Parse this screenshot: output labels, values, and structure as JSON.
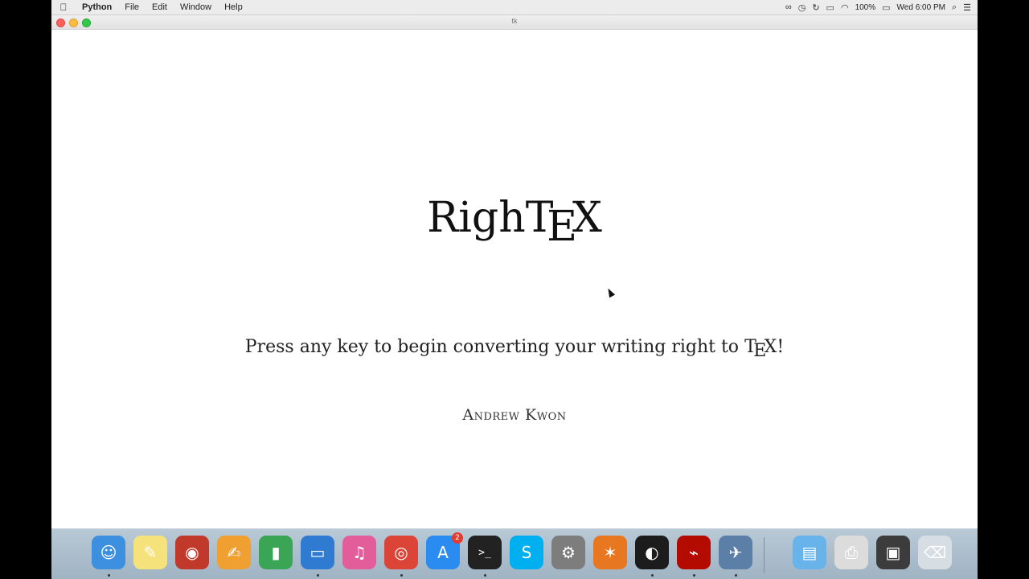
{
  "menubar": {
    "app_name": "Python",
    "menus": [
      "File",
      "Edit",
      "Window",
      "Help"
    ],
    "battery": "100%",
    "clock": "Wed 6:00 PM"
  },
  "window": {
    "title": "tk"
  },
  "content": {
    "logo_prefix": "Righ",
    "logo_tex": {
      "t": "T",
      "e": "E",
      "x": "X"
    },
    "subtitle_prefix": "Press any key to begin converting your writing right to ",
    "subtitle_tex": {
      "t": "T",
      "e": "E",
      "x": "X"
    },
    "subtitle_suffix": "!",
    "author": "Andrew Kwon"
  },
  "dock": {
    "items": [
      {
        "name": "finder",
        "icon": "finder-icon",
        "color": "#3d8fe0",
        "glyph": "☺",
        "running": true
      },
      {
        "name": "notes",
        "icon": "notes-icon",
        "color": "#f5e27a",
        "glyph": "✎",
        "running": false
      },
      {
        "name": "photo-booth",
        "icon": "photo-booth-icon",
        "color": "#c0392b",
        "glyph": "◉",
        "running": false
      },
      {
        "name": "pages",
        "icon": "pages-icon",
        "color": "#f0a030",
        "glyph": "✍",
        "running": false
      },
      {
        "name": "numbers",
        "icon": "numbers-icon",
        "color": "#3aa655",
        "glyph": "▮",
        "running": false
      },
      {
        "name": "keynote",
        "icon": "keynote-icon",
        "color": "#2e7bd1",
        "glyph": "▭",
        "running": true
      },
      {
        "name": "itunes",
        "icon": "itunes-icon",
        "color": "#e35d9a",
        "glyph": "♫",
        "running": false
      },
      {
        "name": "chrome",
        "icon": "chrome-icon",
        "color": "#db4437",
        "glyph": "◎",
        "running": true
      },
      {
        "name": "app-store",
        "icon": "app-store-icon",
        "color": "#2a8cf0",
        "glyph": "A",
        "running": false,
        "badge": "2"
      },
      {
        "name": "terminal",
        "icon": "terminal-icon",
        "color": "#222222",
        "glyph": ">_",
        "running": true
      },
      {
        "name": "skype",
        "icon": "skype-icon",
        "color": "#00aff0",
        "glyph": "S",
        "running": false
      },
      {
        "name": "system-preferences",
        "icon": "gear-icon",
        "color": "#7d7d7d",
        "glyph": "⚙",
        "running": false
      },
      {
        "name": "mathematica",
        "icon": "mathematica-icon",
        "color": "#e87722",
        "glyph": "✶",
        "running": false
      },
      {
        "name": "obs",
        "icon": "obs-icon",
        "color": "#1c1c1c",
        "glyph": "◐",
        "running": true
      },
      {
        "name": "acrobat",
        "icon": "acrobat-icon",
        "color": "#b30b00",
        "glyph": "⌁",
        "running": true
      },
      {
        "name": "python-launcher",
        "icon": "rocket-icon",
        "color": "#5c7fa8",
        "glyph": "✈",
        "running": true
      },
      {
        "name": "downloads",
        "icon": "folder-icon",
        "color": "#68b4ea",
        "glyph": "▤",
        "running": false
      },
      {
        "name": "printer",
        "icon": "printer-icon",
        "color": "#dcdcdc",
        "glyph": "⎙",
        "running": false
      },
      {
        "name": "screenshots",
        "icon": "screen-folder-icon",
        "color": "#3c3c3c",
        "glyph": "▣",
        "running": false
      },
      {
        "name": "trash",
        "icon": "trash-icon",
        "color": "#d6dde3",
        "glyph": "⌫",
        "running": false
      }
    ]
  }
}
